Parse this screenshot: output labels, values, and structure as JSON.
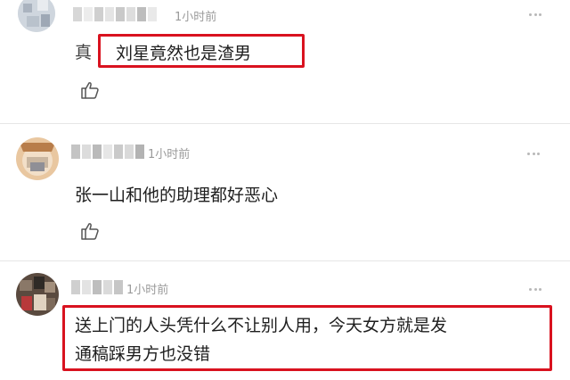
{
  "comments": [
    {
      "time": "1小时前",
      "prefix_char": "真",
      "text": "刘星竟然也是渣男",
      "avatar_icon": "avatar-icon",
      "like_icon": "thumbs-up-icon",
      "more_icon": "more-dots-icon"
    },
    {
      "time": "1小时前",
      "text": "张一山和他的助理都好恶心",
      "avatar_icon": "avatar-icon",
      "like_icon": "thumbs-up-icon",
      "more_icon": "more-dots-icon"
    },
    {
      "time": "1小时前",
      "text_line1": "送上门的人头凭什么不让别人用，今天女方就是发",
      "text_line2": "通稿踩男方也没错",
      "avatar_icon": "avatar-icon",
      "more_icon": "more-dots-icon"
    }
  ],
  "colors": {
    "highlight": "#d9121f",
    "time_text": "#9a9a9a",
    "divider": "#e6e6e6"
  }
}
